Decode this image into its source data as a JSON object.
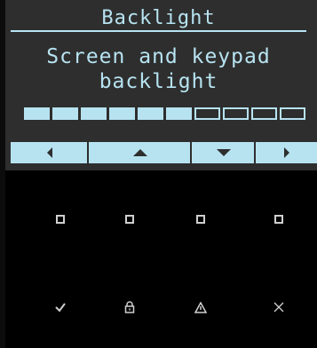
{
  "screen": {
    "title": "Backlight",
    "message_line1": "Screen and keypad",
    "message_line2": "backlight",
    "level": 6,
    "max_level": 10
  },
  "softkeys": [
    {
      "name": "left",
      "icon": "triangle-left-icon"
    },
    {
      "name": "up",
      "icon": "triangle-up-icon"
    },
    {
      "name": "down",
      "icon": "triangle-down-icon"
    },
    {
      "name": "right",
      "icon": "triangle-right-icon"
    }
  ],
  "keypad": {
    "row1": [
      "square-icon",
      "square-icon",
      "square-icon",
      "square-icon"
    ],
    "row2": [
      "check-icon",
      "lock-icon",
      "warning-icon",
      "close-icon"
    ]
  },
  "colors": {
    "lcd_background": "#2e2e2e",
    "lcd_foreground": "#b7e3f1",
    "panel_background": "#000000"
  }
}
